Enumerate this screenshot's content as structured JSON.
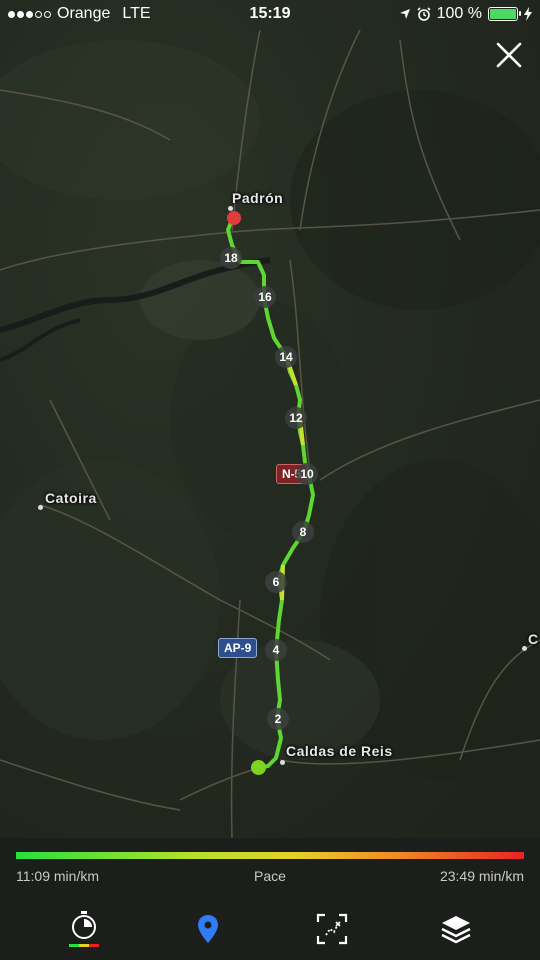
{
  "status_bar": {
    "carrier": "Orange",
    "network": "LTE",
    "time": "15:19",
    "battery": "100 %",
    "signal_bars_filled": 3,
    "signal_bars_total": 5
  },
  "map": {
    "places": {
      "padron": "Padrón",
      "catoira": "Catoira",
      "caldas": "Caldas de Reis",
      "edge": "C"
    },
    "shields": {
      "ap9": "AP-9",
      "n550": "N-5"
    },
    "km_markers": [
      "18",
      "16",
      "14",
      "12",
      "10",
      "8",
      "6",
      "4",
      "2"
    ],
    "colors": {
      "start": "#7ed321",
      "end": "#e23b3b",
      "route_fast": "#59d62f",
      "route_slow": "#c7e032"
    }
  },
  "legend": {
    "min_label": "11:09 min/km",
    "center_label": "Pace",
    "max_label": "23:49 min/km"
  },
  "toolbar": {
    "icons": [
      "stopwatch-pace-icon",
      "map-pin-icon",
      "fit-route-icon",
      "layers-icon"
    ],
    "active_color": "#2f7cf6"
  }
}
